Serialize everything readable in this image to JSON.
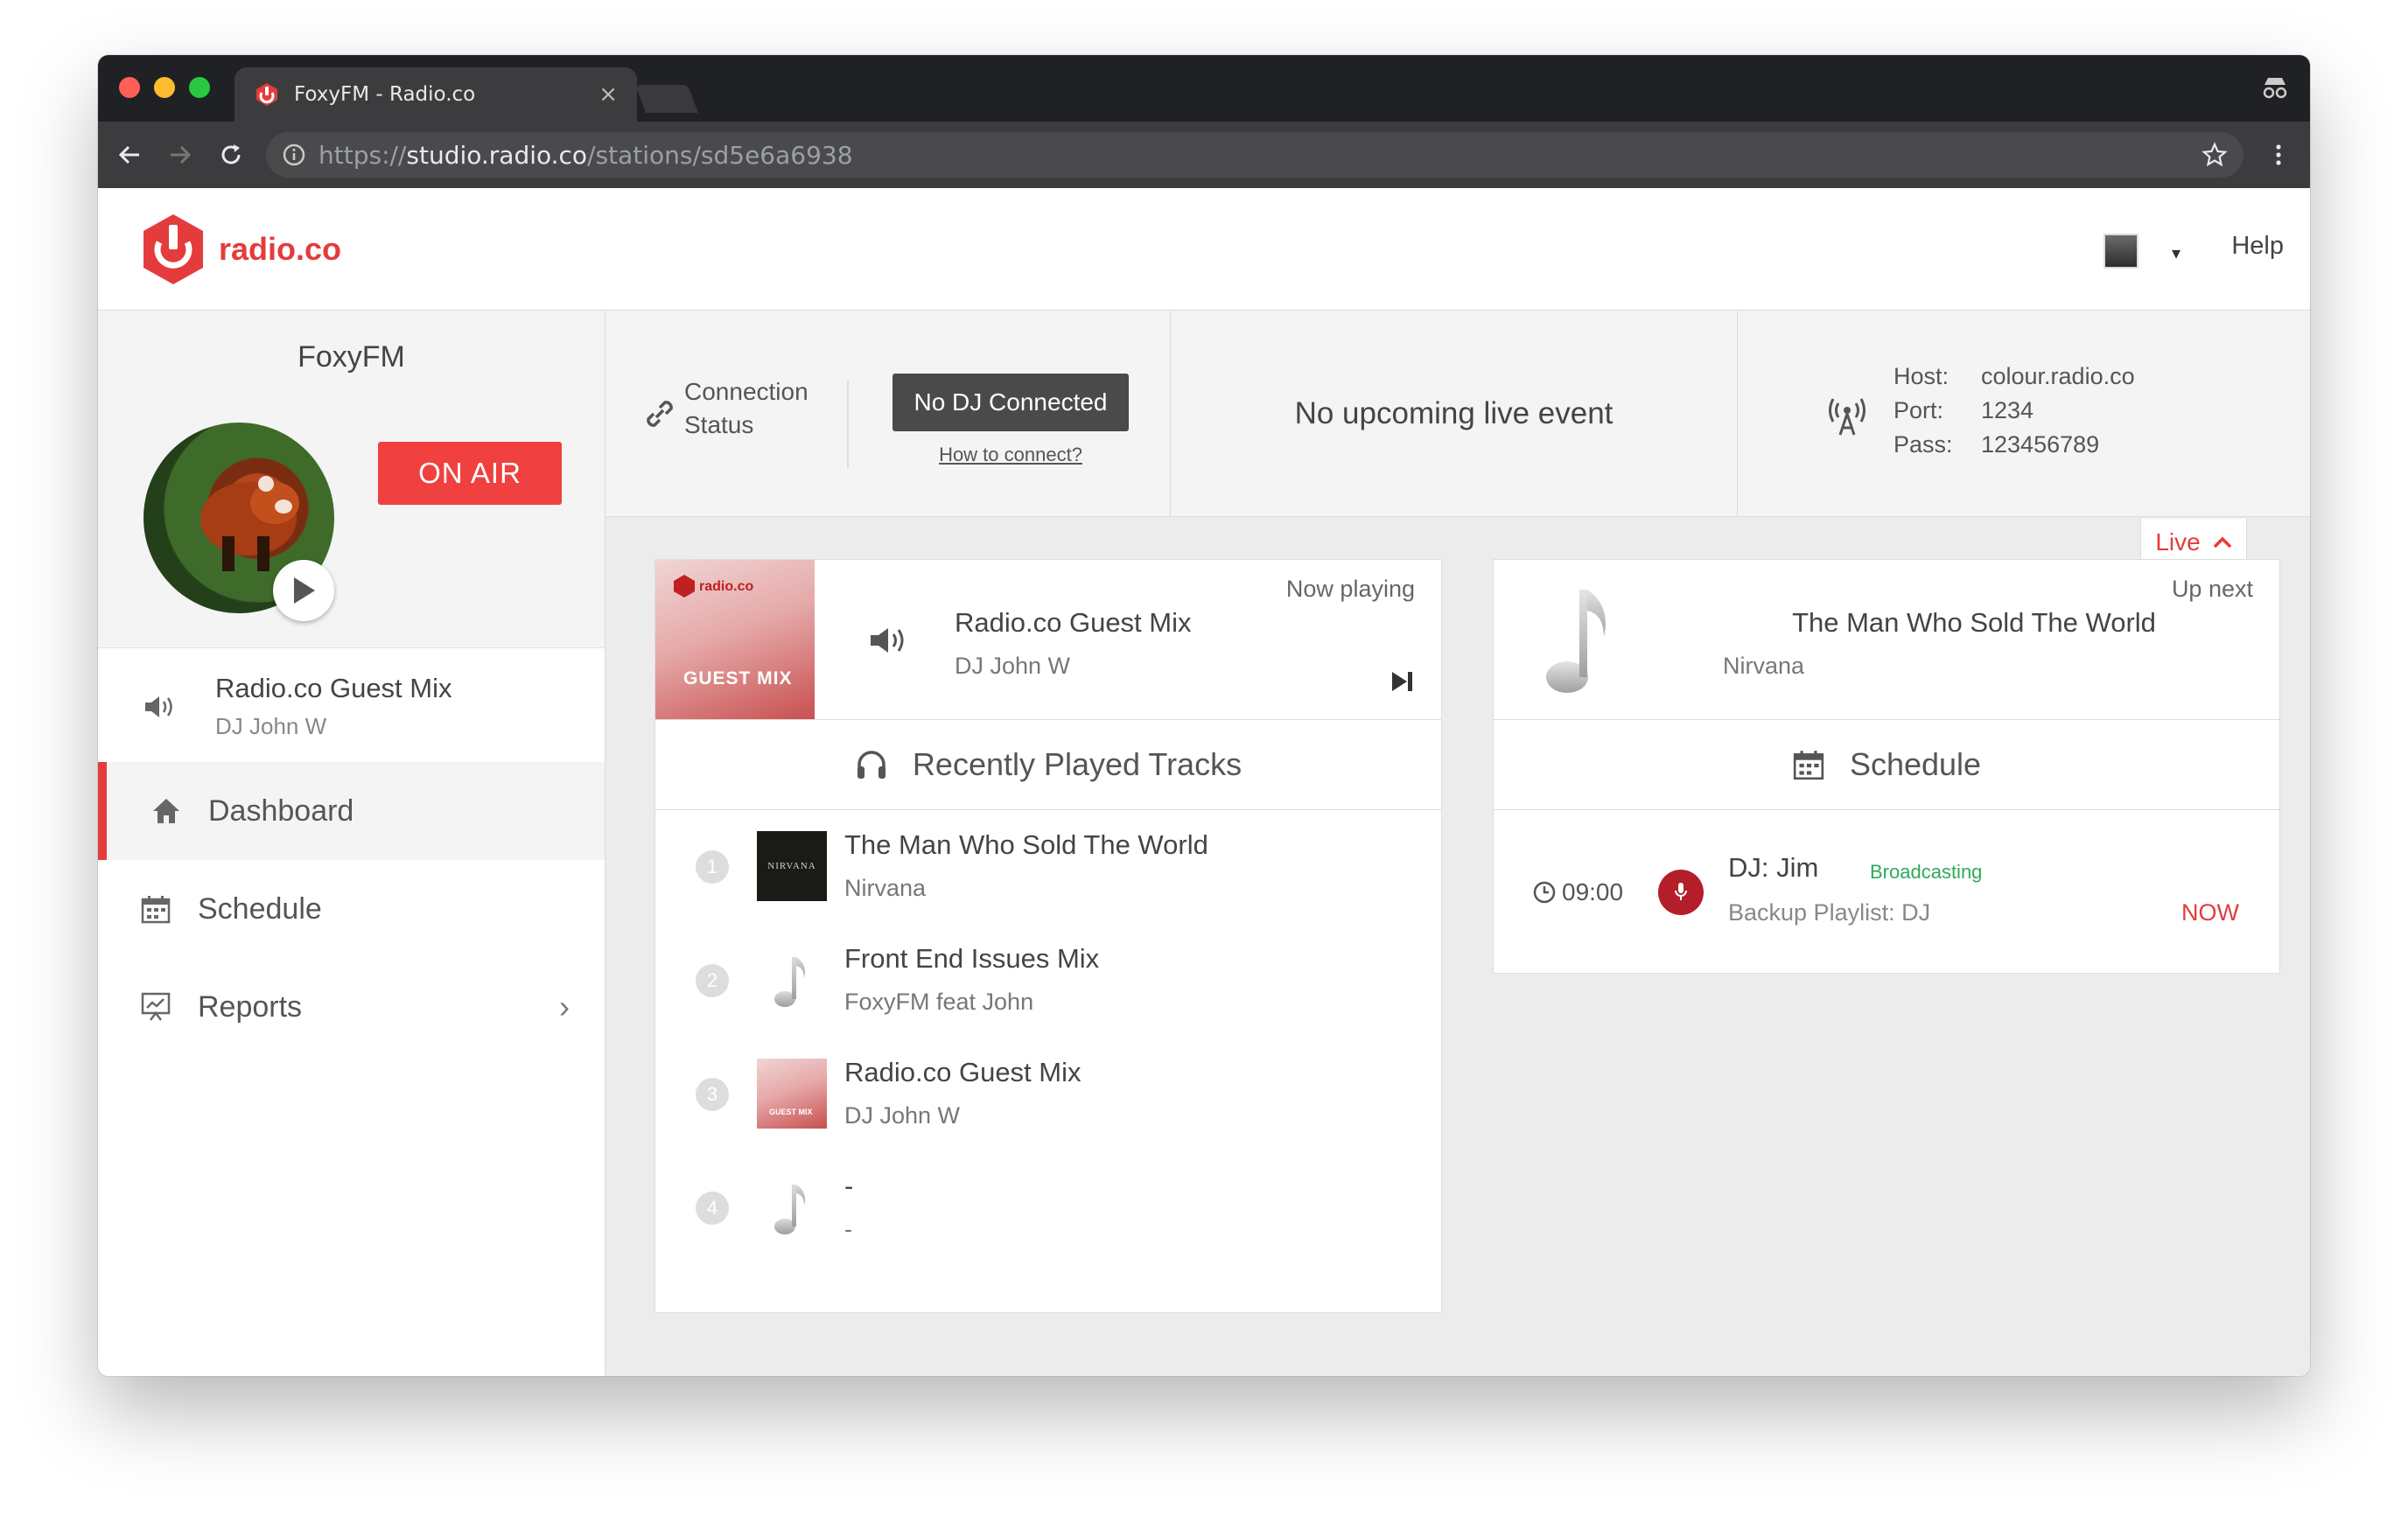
{
  "browser": {
    "tab_title": "FoxyFM - Radio.co",
    "tab_close": "×",
    "url_scheme": "https://",
    "url_host": "studio.radio.co",
    "url_path": "/stations/sd5e6a6938"
  },
  "header": {
    "logo_text": "radio.co",
    "help_label": "Help",
    "caret": "▾"
  },
  "sidebar": {
    "station_name": "FoxyFM",
    "on_air_label": "ON AIR",
    "now_playing": {
      "title": "Radio.co Guest Mix",
      "artist": "DJ John W"
    },
    "nav": [
      {
        "label": "Dashboard",
        "icon": "home-icon",
        "active": true
      },
      {
        "label": "Schedule",
        "icon": "calendar-icon",
        "active": false
      },
      {
        "label": "Reports",
        "icon": "reports-icon",
        "active": false,
        "chevron": "›"
      }
    ]
  },
  "status": {
    "connection_label": "Connection Status",
    "no_dj_label": "No DJ Connected",
    "how_to_connect": "How to connect?",
    "upcoming": "No upcoming live event",
    "host_label": "Host:",
    "host_value": "colour.radio.co",
    "port_label": "Port:",
    "port_value": "1234",
    "pass_label": "Pass:",
    "pass_value": "123456789"
  },
  "live_toggle": {
    "label": "Live"
  },
  "now_playing": {
    "badge": "Now playing",
    "title": "Radio.co Guest Mix",
    "artist": "DJ John W",
    "art_logo": "radio.co",
    "art_text": "GUEST MIX"
  },
  "recent": {
    "heading": "Recently Played Tracks",
    "tracks": [
      {
        "num": "1",
        "title": "The Man Who Sold The World",
        "artist": "Nirvana",
        "thumb": "nirvana-album-art",
        "thumb_text": "NIRVANA"
      },
      {
        "num": "2",
        "title": "Front End Issues Mix",
        "artist": "FoxyFM feat John",
        "thumb": "music-note-icon"
      },
      {
        "num": "3",
        "title": "Radio.co Guest Mix",
        "artist": "DJ John W",
        "thumb": "guest-mix-art",
        "thumb_text": "GUEST MIX"
      },
      {
        "num": "4",
        "title": "-",
        "artist": "-",
        "thumb": "music-note-icon"
      }
    ]
  },
  "up_next": {
    "badge": "Up next",
    "title": "The Man Who Sold The World",
    "artist": "Nirvana"
  },
  "schedule": {
    "heading": "Schedule",
    "time": "09:00",
    "dj": "DJ: Jim",
    "status": "Broadcasting",
    "playlist": "Backup Playlist: DJ",
    "now_label": "NOW"
  },
  "colors": {
    "accent": "#e43c3c",
    "broadcasting": "#2eaa5a",
    "mic": "#b41e2a",
    "dark_button": "#4a4a4a"
  }
}
